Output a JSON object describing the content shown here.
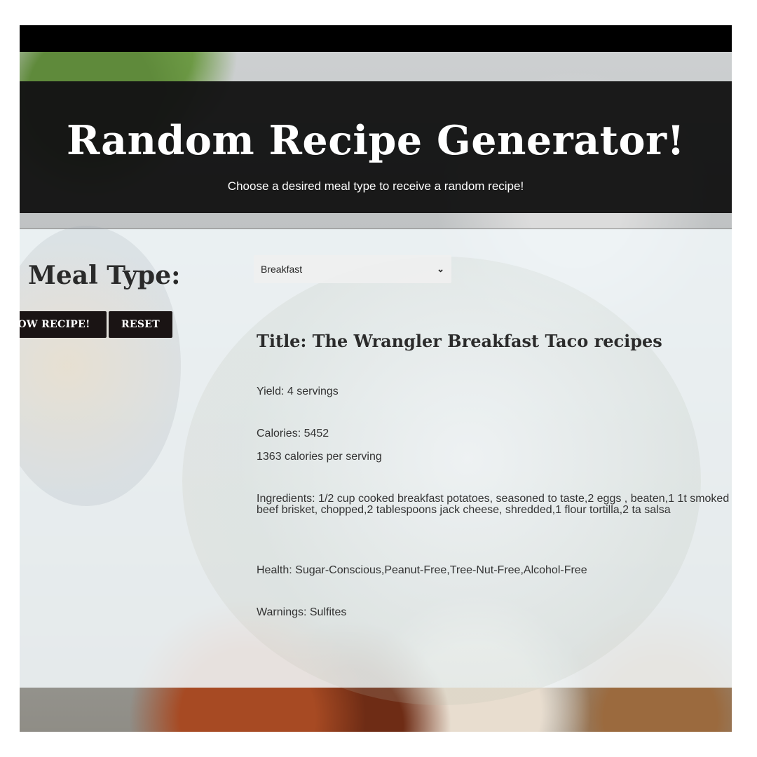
{
  "header": {
    "title": "Random Recipe Generator!",
    "subtitle": "Choose a desired meal type to receive a random recipe!"
  },
  "controls": {
    "meal_type_label": "Meal Type:",
    "meal_select_value": "Breakfast",
    "show_button": "OW RECIPE!",
    "reset_button": "RESET"
  },
  "recipe": {
    "title": "Title: The Wrangler Breakfast Taco recipes",
    "yield": "Yield: 4 servings",
    "calories": "Calories: 5452",
    "calories_per_serving": "1363 calories per serving",
    "ingredients": "Ingredients: 1/2 cup cooked breakfast potatoes, seasoned to taste,2 eggs , beaten,1 1t smoked beef brisket, chopped,2 tablespoons jack cheese, shredded,1 flour tortilla,2 ta salsa",
    "health": "Health: Sugar-Conscious,Peanut-Free,Tree-Nut-Free,Alcohol-Free",
    "warnings": "Warnings: Sulfites"
  }
}
